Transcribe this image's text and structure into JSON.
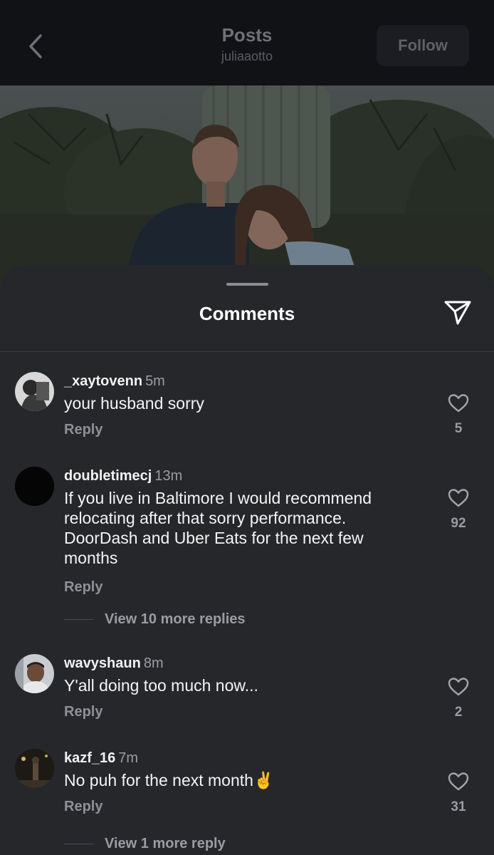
{
  "header": {
    "title": "Posts",
    "username": "juliaaotto",
    "follow_label": "Follow"
  },
  "sheet": {
    "title": "Comments"
  },
  "comments": [
    {
      "username": "_xaytovenn",
      "time": "5m",
      "text": "your husband sorry",
      "reply_label": "Reply",
      "likes": "5"
    },
    {
      "username": "doubletimecj",
      "time": "13m",
      "text": "If you live in Baltimore I would recommend relocating after that sorry performance. DoorDash and Uber Eats for the next few months",
      "reply_label": "Reply",
      "likes": "92",
      "view_more": "View 10 more replies"
    },
    {
      "username": "wavyshaun",
      "time": "8m",
      "text": "Y'all doing too much now...",
      "reply_label": "Reply",
      "likes": "2"
    },
    {
      "username": "kazf_16",
      "time": "7m",
      "text": "No puh for the next month✌️",
      "reply_label": "Reply",
      "likes": "31",
      "view_more": "View 1 more reply"
    }
  ],
  "icons": {
    "back": "chevron-left-icon",
    "share": "paper-plane-icon",
    "like": "heart-outline-icon"
  },
  "colors": {
    "sheet_background": "#26272b",
    "topbar_background": "#111216"
  }
}
